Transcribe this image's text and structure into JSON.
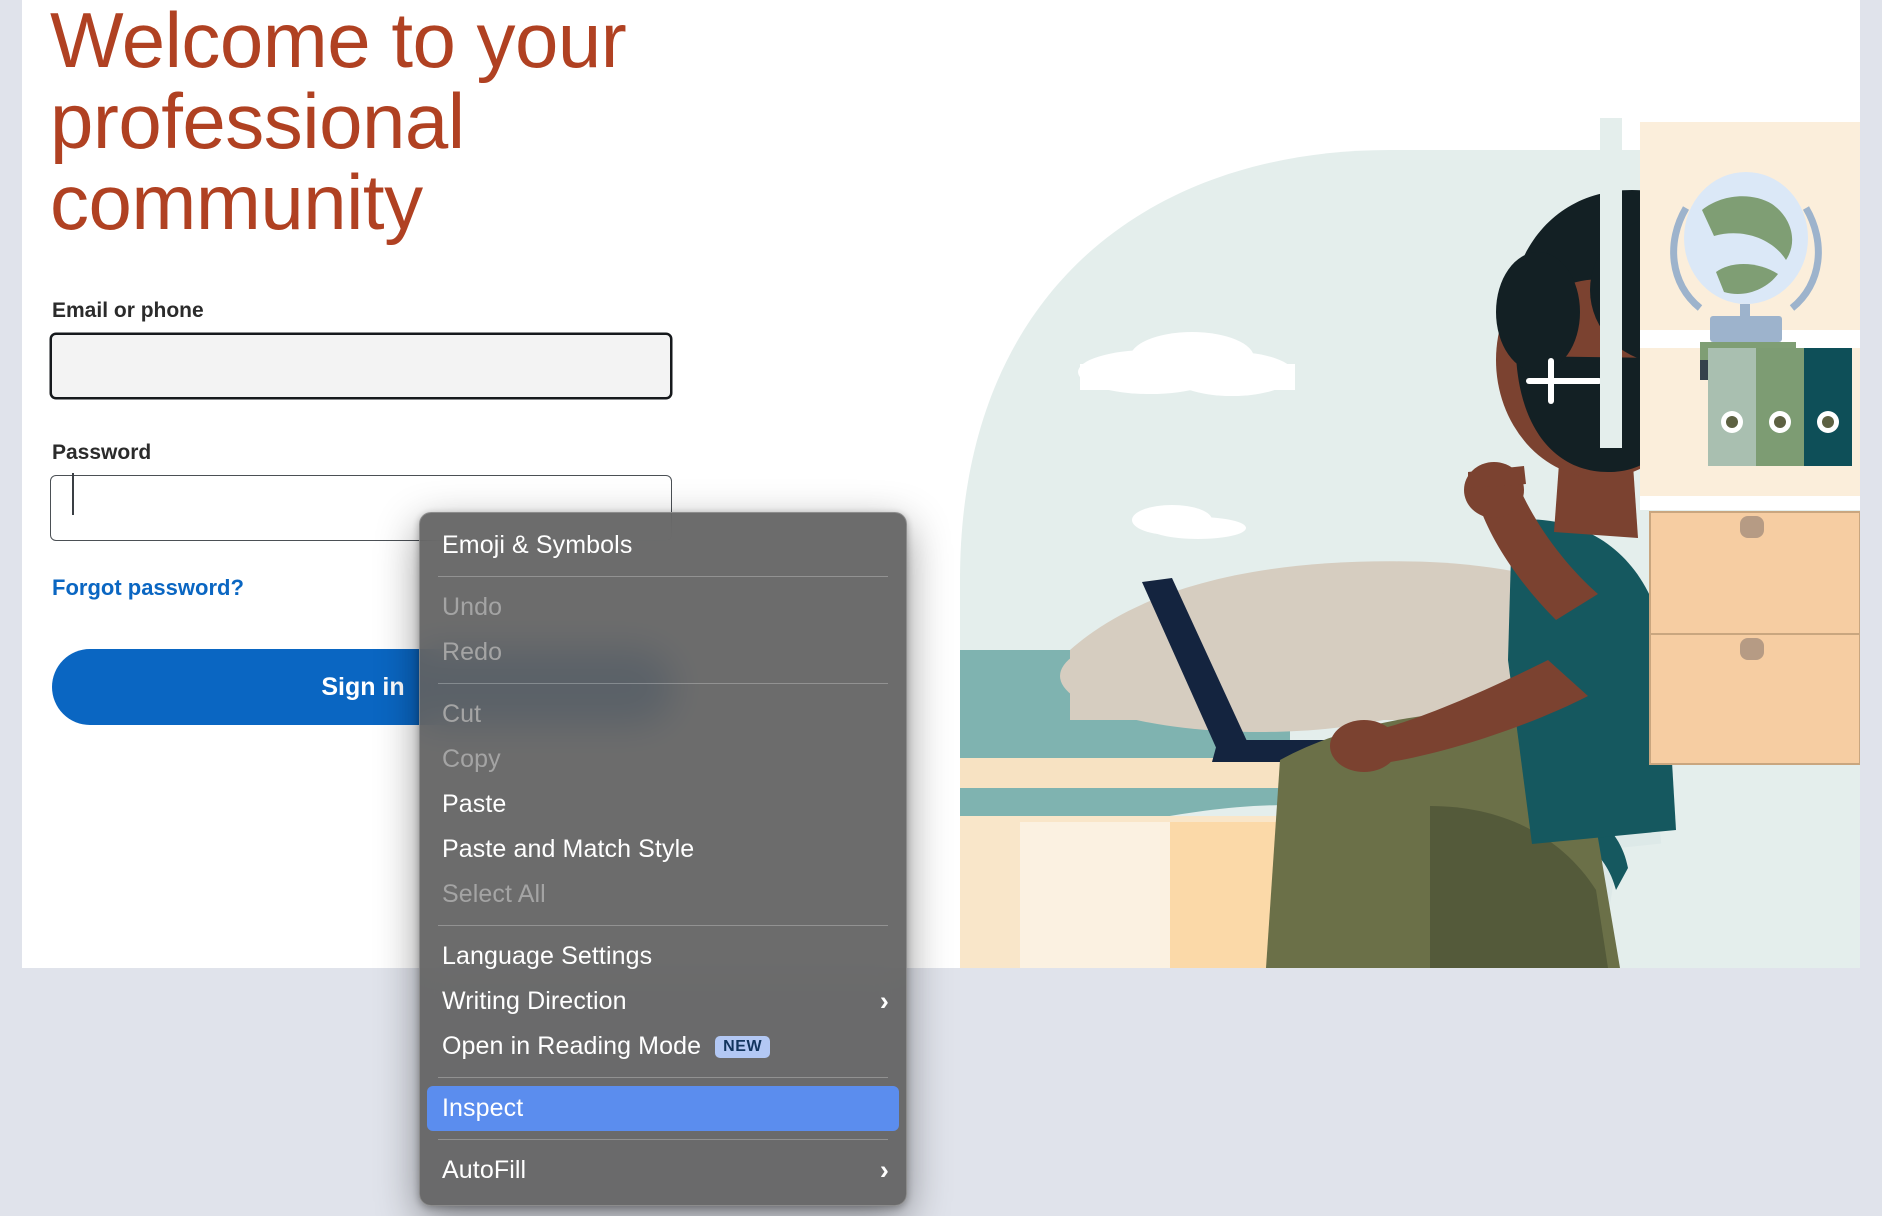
{
  "page": {
    "background_color": "#e0e3eb",
    "card_background": "#ffffff"
  },
  "hero": {
    "headline": "Welcome to your\nprofessional\ncommunity",
    "headline_color": "#b04122"
  },
  "form": {
    "email": {
      "label": "Email or phone",
      "value": "",
      "placeholder": "",
      "focused": true
    },
    "password": {
      "label": "Password",
      "value": "",
      "placeholder": "",
      "focused": false
    },
    "forgot_password_label": "Forgot password?",
    "forgot_password_color": "#0a66c2",
    "submit_label": "Sign in",
    "submit_color": "#0a66c2"
  },
  "illustration": {
    "name": "person-working-on-laptop-illustration",
    "elements": [
      "sky-arc",
      "cloud-large",
      "cloud-small",
      "sea",
      "sand",
      "laptop",
      "person",
      "chair",
      "bookshelf",
      "globe",
      "binders",
      "drawers"
    ],
    "colors": {
      "sky": "#e4eeec",
      "sea": "#7fb3b0",
      "sand": "#f7e2c2",
      "desk": "#d6cdc0",
      "laptop": "#14243f",
      "skin": "#7b4230",
      "hair": "#132024",
      "shirt": "#15585f",
      "pants": "#6b7048",
      "shelf": "#fbeedb",
      "globe_land": "#7f9e74",
      "globe_sea": "#dbe8f7",
      "binder_1": "#a9bfb0",
      "binder_2": "#7d9c73",
      "binder_3": "#0e4f58",
      "drawer": "#f6cda2",
      "chair": "#dde9e8"
    }
  },
  "context_menu": {
    "background_color": "#616161",
    "highlight_color": "#5b8dee",
    "items": [
      {
        "label": "Emoji & Symbols",
        "state": "enabled",
        "submenu": false,
        "badge": null
      },
      {
        "separator": true
      },
      {
        "label": "Undo",
        "state": "disabled",
        "submenu": false,
        "badge": null
      },
      {
        "label": "Redo",
        "state": "disabled",
        "submenu": false,
        "badge": null
      },
      {
        "separator": true
      },
      {
        "label": "Cut",
        "state": "disabled",
        "submenu": false,
        "badge": null
      },
      {
        "label": "Copy",
        "state": "disabled",
        "submenu": false,
        "badge": null
      },
      {
        "label": "Paste",
        "state": "enabled",
        "submenu": false,
        "badge": null
      },
      {
        "label": "Paste and Match Style",
        "state": "enabled",
        "submenu": false,
        "badge": null
      },
      {
        "label": "Select All",
        "state": "disabled",
        "submenu": false,
        "badge": null
      },
      {
        "separator": true
      },
      {
        "label": "Language Settings",
        "state": "enabled",
        "submenu": false,
        "badge": null
      },
      {
        "label": "Writing Direction",
        "state": "enabled",
        "submenu": true,
        "badge": null
      },
      {
        "label": "Open in Reading Mode",
        "state": "enabled",
        "submenu": false,
        "badge": "NEW"
      },
      {
        "separator": true
      },
      {
        "label": "Inspect",
        "state": "highlighted",
        "submenu": false,
        "badge": null
      },
      {
        "separator": true
      },
      {
        "label": "AutoFill",
        "state": "enabled",
        "submenu": true,
        "badge": null
      }
    ],
    "chevron_glyph": "›"
  }
}
